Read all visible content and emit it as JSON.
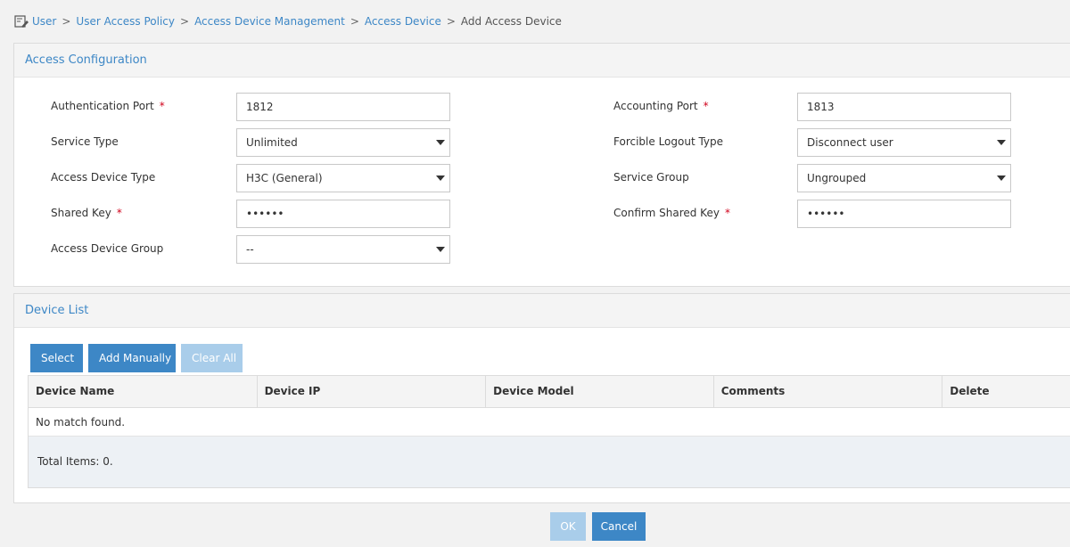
{
  "breadcrumb": {
    "items": [
      "User",
      "User Access Policy",
      "Access Device Management",
      "Access Device"
    ],
    "current": "Add Access Device",
    "separator": ">"
  },
  "access_config": {
    "title": "Access Configuration",
    "auth_port": {
      "label": "Authentication Port",
      "required": "*",
      "value": "1812"
    },
    "acct_port": {
      "label": "Accounting Port",
      "required": "*",
      "value": "1813"
    },
    "service_type": {
      "label": "Service Type",
      "value": "Unlimited"
    },
    "logout_type": {
      "label": "Forcible Logout Type",
      "value": "Disconnect user"
    },
    "device_type": {
      "label": "Access Device Type",
      "value": "H3C (General)"
    },
    "service_group": {
      "label": "Service Group",
      "value": "Ungrouped"
    },
    "shared_key": {
      "label": "Shared Key",
      "required": "*",
      "value": "••••••"
    },
    "confirm_key": {
      "label": "Confirm Shared Key",
      "required": "*",
      "value": "••••••"
    },
    "device_group": {
      "label": "Access Device Group",
      "value": "--"
    }
  },
  "device_list": {
    "title": "Device List",
    "buttons": {
      "select": "Select",
      "add_manually": "Add Manually",
      "clear_all": "Clear All"
    },
    "columns": [
      "Device Name",
      "Device IP",
      "Device Model",
      "Comments",
      "Delete"
    ],
    "empty_text": "No match found.",
    "total_text": "Total Items: 0."
  },
  "footer": {
    "ok": "OK",
    "cancel": "Cancel"
  },
  "icons": {
    "breadcrumb": "edit-document-icon",
    "dropdown": "caret-down-icon"
  },
  "colors": {
    "accent": "#3d87c6",
    "accent_disabled": "#a9cdea",
    "required": "#d0021b"
  }
}
